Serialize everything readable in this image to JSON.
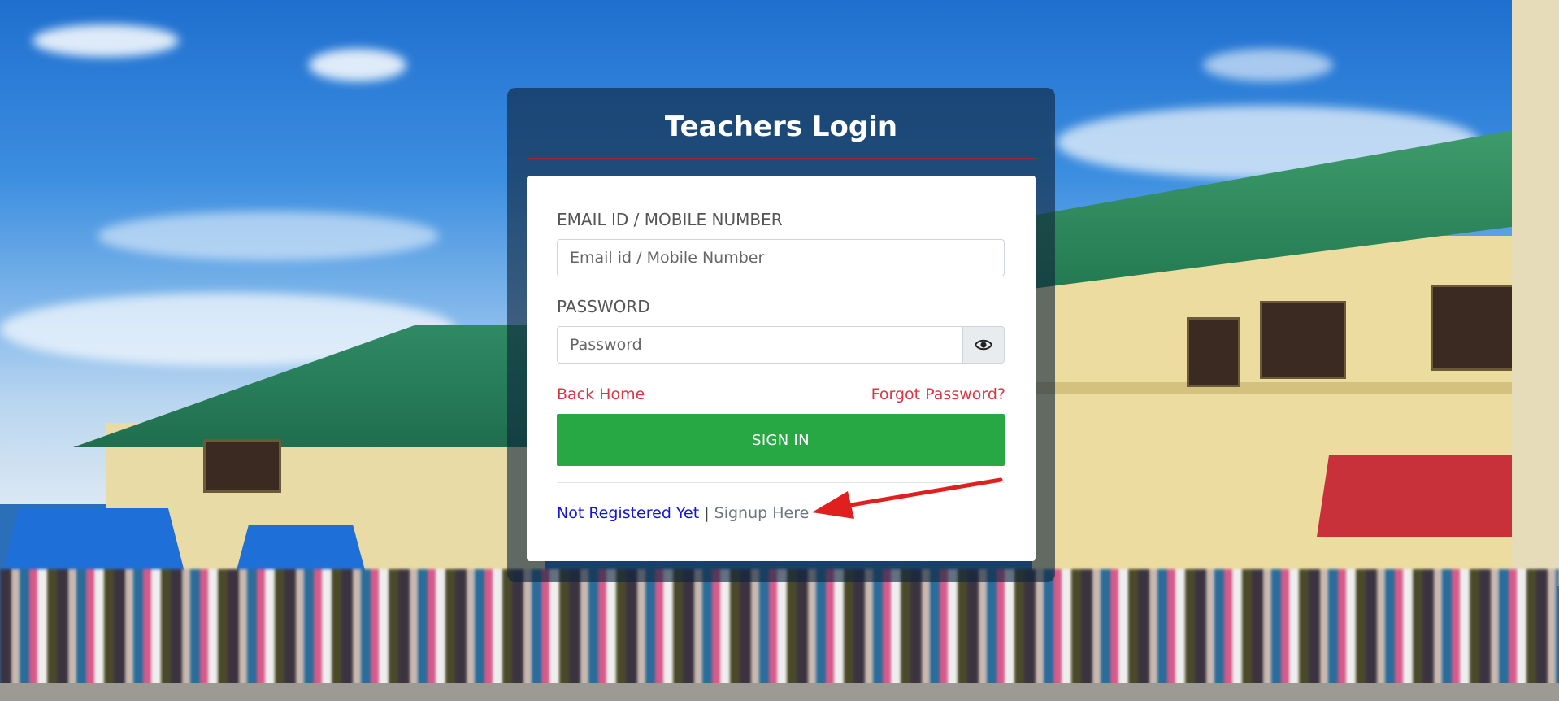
{
  "login": {
    "title": "Teachers Login",
    "email_label": "EMAIL ID / MOBILE NUMBER",
    "email_placeholder": "Email id / Mobile Number",
    "email_value": "",
    "password_label": "PASSWORD",
    "password_placeholder": "Password",
    "password_value": "",
    "back_home": "Back Home",
    "forgot_password": "Forgot Password?",
    "sign_in": "SIGN IN",
    "not_registered": "Not Registered Yet",
    "separator": "|",
    "signup": "Signup Here"
  },
  "icons": {
    "password_toggle": "eye-icon",
    "annotation": "red-arrow-icon"
  },
  "colors": {
    "accent_red": "#dc3545",
    "sign_in_green": "#28a745",
    "not_registered_blue": "#1515d6",
    "title_rule": "#a02632"
  }
}
